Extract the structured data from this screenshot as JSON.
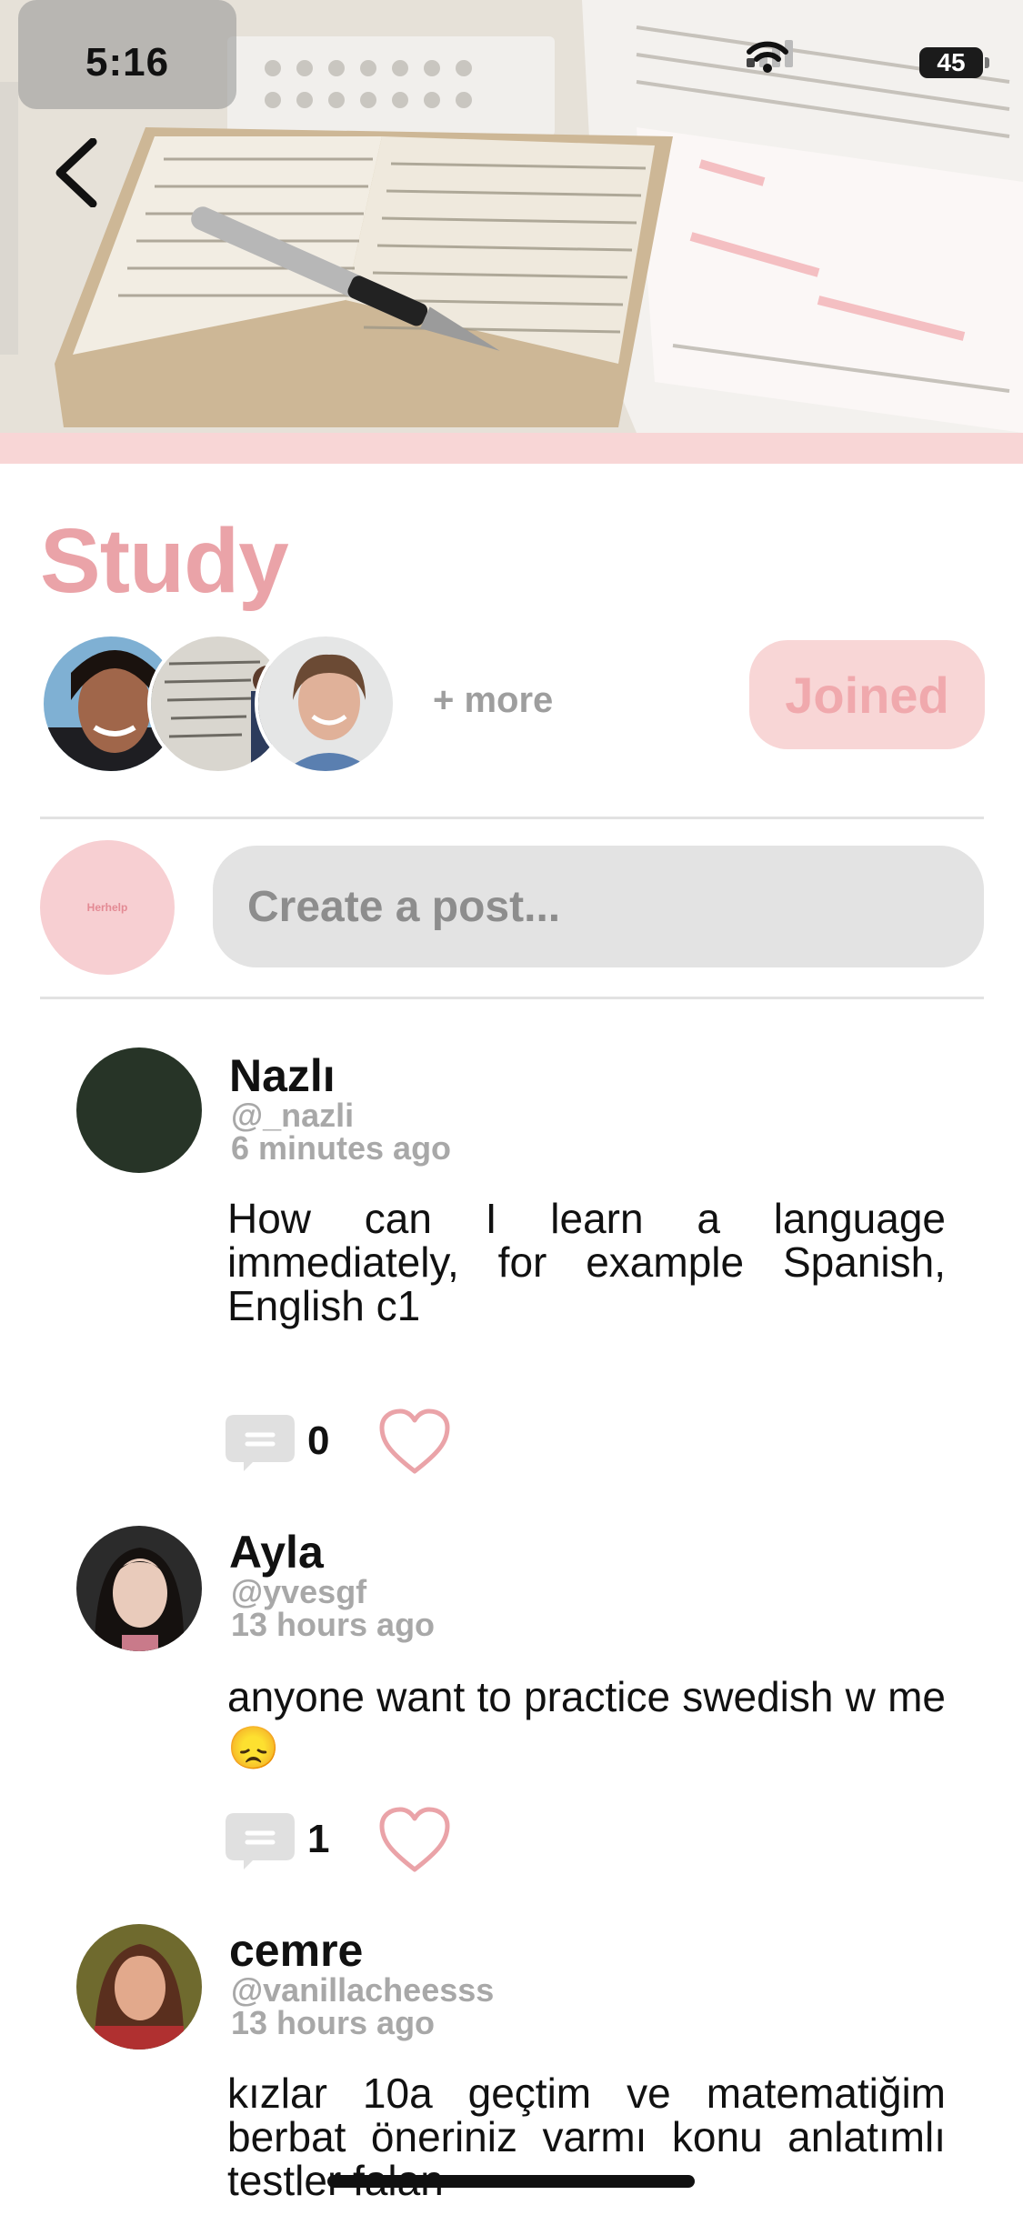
{
  "status_bar": {
    "time": "5:16",
    "battery": "45"
  },
  "community": {
    "title": "Study",
    "more_label": "+ more",
    "joined_label": "Joined"
  },
  "composer": {
    "avatar_text": "Herhelp",
    "placeholder": "Create a post..."
  },
  "posts": [
    {
      "name": "Nazlı",
      "handle": "@_nazli",
      "time": "6 minutes ago",
      "body": "How can I learn a language immediately, for example Spanish, English c1",
      "comments": "0"
    },
    {
      "name": "Ayla",
      "handle": "@yvesgf",
      "time": "13 hours ago",
      "body": "anyone want to practice swedish w me 😞",
      "comments": "1"
    },
    {
      "name": "cemre",
      "handle": "@vanillacheesss",
      "time": "13 hours ago",
      "body": "kızlar 10a geçtim ve matematiğim berbat öneriniz varmı konu anlatımlı testler falan"
    }
  ],
  "colors": {
    "accent_pink": "#eaa3a8",
    "joined_bg": "#f8d6d6",
    "input_bg": "#e3e3e3"
  },
  "icons": [
    "back-chevron-icon",
    "signal-icon",
    "wifi-icon",
    "battery-icon",
    "comment-icon",
    "heart-icon"
  ]
}
